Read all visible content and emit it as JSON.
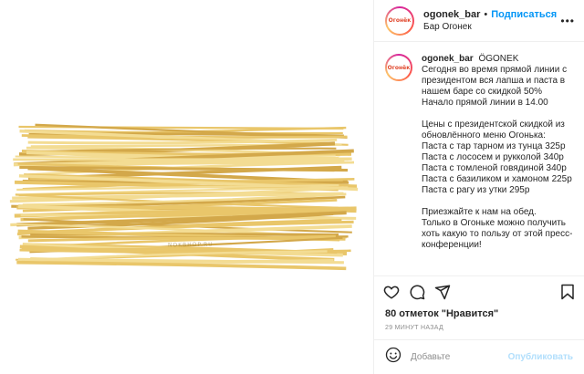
{
  "post": {
    "username": "ogonek_bar",
    "dot": "•",
    "follow_label": "Подписаться",
    "location": "Бар Огонек",
    "avatar_text": "Огонёк"
  },
  "photo": {
    "watermark": "NOKBHOP.RU",
    "colors": {
      "pasta_light": "#f3dc93",
      "pasta_mid": "#e9c66a",
      "pasta_dark": "#d3a84a"
    }
  },
  "caption": {
    "username": "ogonek_bar",
    "lines_1": [
      "ÖGONEK",
      "Сегодня во время прямой линии с",
      "президентом вся лапша и паста в",
      "нашем баре со скидкой 50%",
      "Начало прямой линии в 14.00"
    ],
    "lines_2": [
      "Цены с президентской скидкой из",
      "обновлённого меню Огонька:",
      "Паста с тар тарном из тунца 325р",
      "Паста с лососем и рукколой 340р",
      "Паста с томленой говядиной 340р",
      "Паста с базиликом и хамоном 225р",
      "Паста с рагу из утки 295р"
    ],
    "lines_3": [
      "Приезжайте к нам на обед.",
      "Только в Огоньке можно получить",
      "хоть какую то пользу от этой пресс-",
      "конференции!"
    ]
  },
  "actions": {
    "icons": [
      "heart-icon",
      "comment-icon",
      "share-icon",
      "bookmark-icon"
    ]
  },
  "likes": "80 отметок \"Нравится\"",
  "time": "29 МИНУТ НАЗАД",
  "comment": {
    "placeholder": "Добавьте",
    "publish_label": "Опубликовать"
  }
}
